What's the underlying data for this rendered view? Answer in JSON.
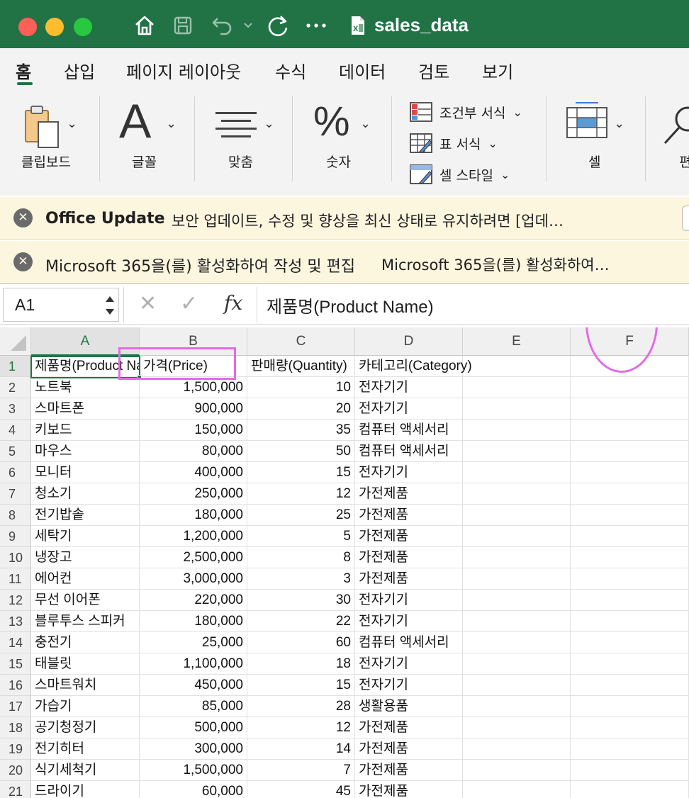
{
  "window": {
    "title": "sales_data"
  },
  "menu": {
    "tabs": [
      "홈",
      "삽입",
      "페이지 레이아웃",
      "수식",
      "데이터",
      "검토",
      "보기"
    ],
    "active": "홈"
  },
  "ribbon": {
    "clipboard": "클립보드",
    "font": "글꼴",
    "alignment": "맞춤",
    "number": "숫자",
    "conditional_format": "조건부 서식",
    "table_format": "표 서식",
    "cell_style": "셀 스타일",
    "cells": "셀",
    "editing": "편집"
  },
  "notifications": [
    {
      "title": "Office Update",
      "message": "보안 업데이트, 수정 및 향상을 최신 상태로 유지하려면 [업데…"
    },
    {
      "title": "Microsoft 365을(를) 활성화하여 작성 및 편집",
      "message": "Microsoft 365을(를) 활성화하여…"
    }
  ],
  "formula_bar": {
    "name_box": "A1",
    "fx": "fx",
    "content": "제품명(Product Name)"
  },
  "grid": {
    "columns": [
      "A",
      "B",
      "C",
      "D",
      "E",
      "F"
    ],
    "header_row": [
      "제품명(Product Name)",
      "가격(Price)",
      "판매량(Quantity)",
      "카테고리(Category)"
    ],
    "row_numbers": [
      "1",
      "2",
      "3",
      "4",
      "5",
      "6",
      "7",
      "8",
      "9",
      "10",
      "11",
      "12",
      "13",
      "14",
      "15",
      "16",
      "17",
      "18",
      "19",
      "20",
      "21"
    ],
    "rows": [
      [
        "노트북",
        "1,500,000",
        "10",
        "전자기기"
      ],
      [
        "스마트폰",
        "900,000",
        "20",
        "전자기기"
      ],
      [
        "키보드",
        "150,000",
        "35",
        "컴퓨터 액세서리"
      ],
      [
        "마우스",
        "80,000",
        "50",
        "컴퓨터 액세서리"
      ],
      [
        "모니터",
        "400,000",
        "15",
        "전자기기"
      ],
      [
        "청소기",
        "250,000",
        "12",
        "가전제품"
      ],
      [
        "전기밥솥",
        "180,000",
        "25",
        "가전제품"
      ],
      [
        "세탁기",
        "1,200,000",
        "5",
        "가전제품"
      ],
      [
        "냉장고",
        "2,500,000",
        "8",
        "가전제품"
      ],
      [
        "에어컨",
        "3,000,000",
        "3",
        "가전제품"
      ],
      [
        "무선 이어폰",
        "220,000",
        "30",
        "전자기기"
      ],
      [
        "블루투스 스피커",
        "180,000",
        "22",
        "전자기기"
      ],
      [
        "충전기",
        "25,000",
        "60",
        "컴퓨터 액세서리"
      ],
      [
        "태블릿",
        "1,100,000",
        "18",
        "전자기기"
      ],
      [
        "스마트워치",
        "450,000",
        "15",
        "전자기기"
      ],
      [
        "가습기",
        "85,000",
        "28",
        "생활용품"
      ],
      [
        "공기청정기",
        "500,000",
        "12",
        "가전제품"
      ],
      [
        "전기히터",
        "300,000",
        "14",
        "가전제품"
      ],
      [
        "식기세척기",
        "1,500,000",
        "7",
        "가전제품"
      ],
      [
        "드라이기",
        "60,000",
        "45",
        "가전제품"
      ]
    ]
  },
  "colors": {
    "brand": "#217346",
    "annotation": "#e26be6"
  }
}
